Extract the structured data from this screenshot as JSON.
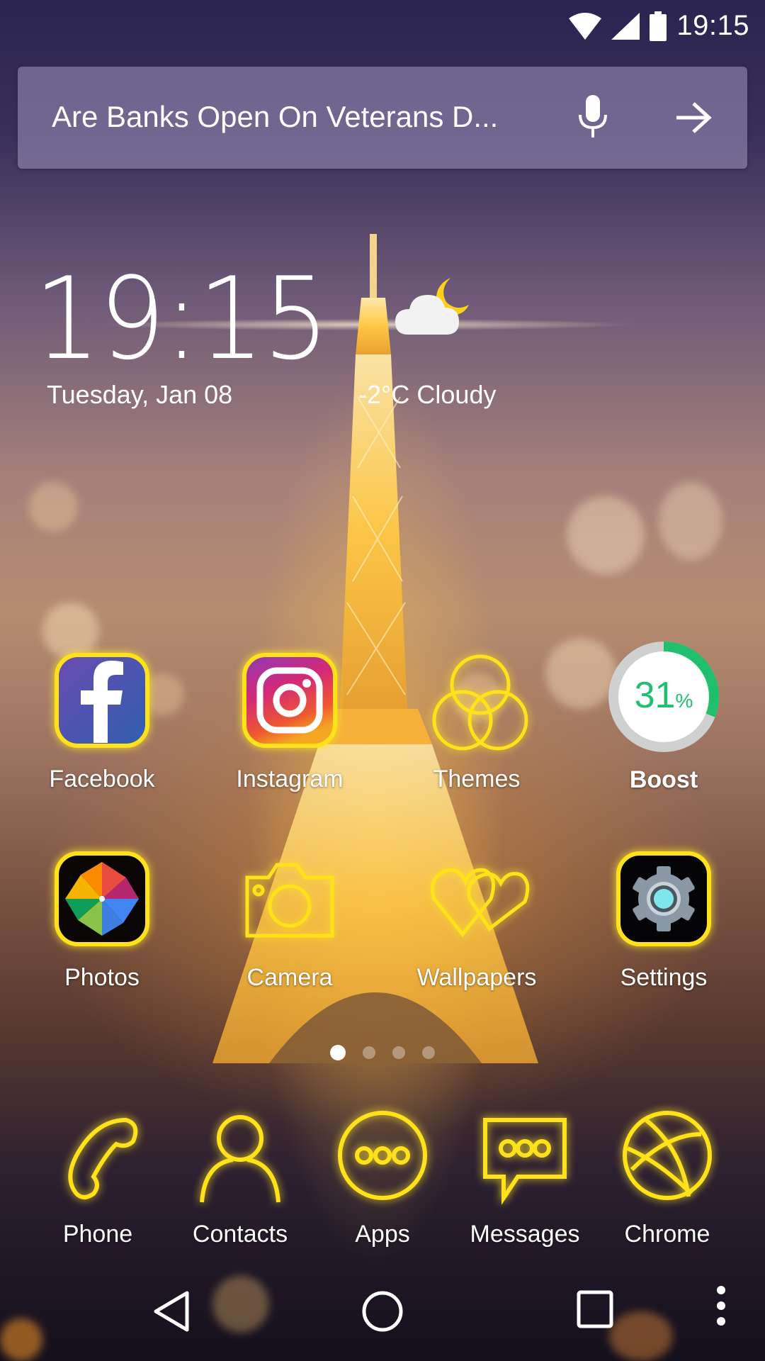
{
  "status_bar": {
    "time": "19:15",
    "icons": [
      "wifi-icon",
      "cell-signal-icon",
      "battery-icon"
    ]
  },
  "search": {
    "query": "Are Banks Open On Veterans D...",
    "mic_icon": "microphone-icon",
    "go_icon": "arrow-right-icon"
  },
  "clock_widget": {
    "time": "19:15",
    "date": "Tuesday, Jan 08",
    "weather_icon": "cloud-moon-icon",
    "weather": "-2°C Cloudy"
  },
  "apps_row1": [
    {
      "label": "Facebook",
      "icon": "facebook-icon"
    },
    {
      "label": "Instagram",
      "icon": "instagram-icon"
    },
    {
      "label": "Themes",
      "icon": "themes-rings-icon"
    },
    {
      "label": "Boost",
      "icon": "boost-gauge",
      "percent": 31,
      "percent_text": "31",
      "percent_sign": "%"
    }
  ],
  "apps_row2": [
    {
      "label": "Photos",
      "icon": "photos-pinwheel-icon"
    },
    {
      "label": "Camera",
      "icon": "camera-icon"
    },
    {
      "label": "Wallpapers",
      "icon": "hearts-icon"
    },
    {
      "label": "Settings",
      "icon": "gear-icon"
    }
  ],
  "page_indicator": {
    "pages": 4,
    "active": 1
  },
  "dock": [
    {
      "label": "Phone",
      "icon": "phone-icon"
    },
    {
      "label": "Contacts",
      "icon": "person-icon"
    },
    {
      "label": "Apps",
      "icon": "app-drawer-icon"
    },
    {
      "label": "Messages",
      "icon": "chat-bubble-icon"
    },
    {
      "label": "Chrome",
      "icon": "globe-icon"
    }
  ],
  "nav_bar": [
    "back-icon",
    "home-icon",
    "recents-icon",
    "more-vert-icon"
  ],
  "colors": {
    "accent_glow": "#ffe21a",
    "boost_green": "#1fbf6e",
    "boost_track": "#d0d0d0"
  }
}
